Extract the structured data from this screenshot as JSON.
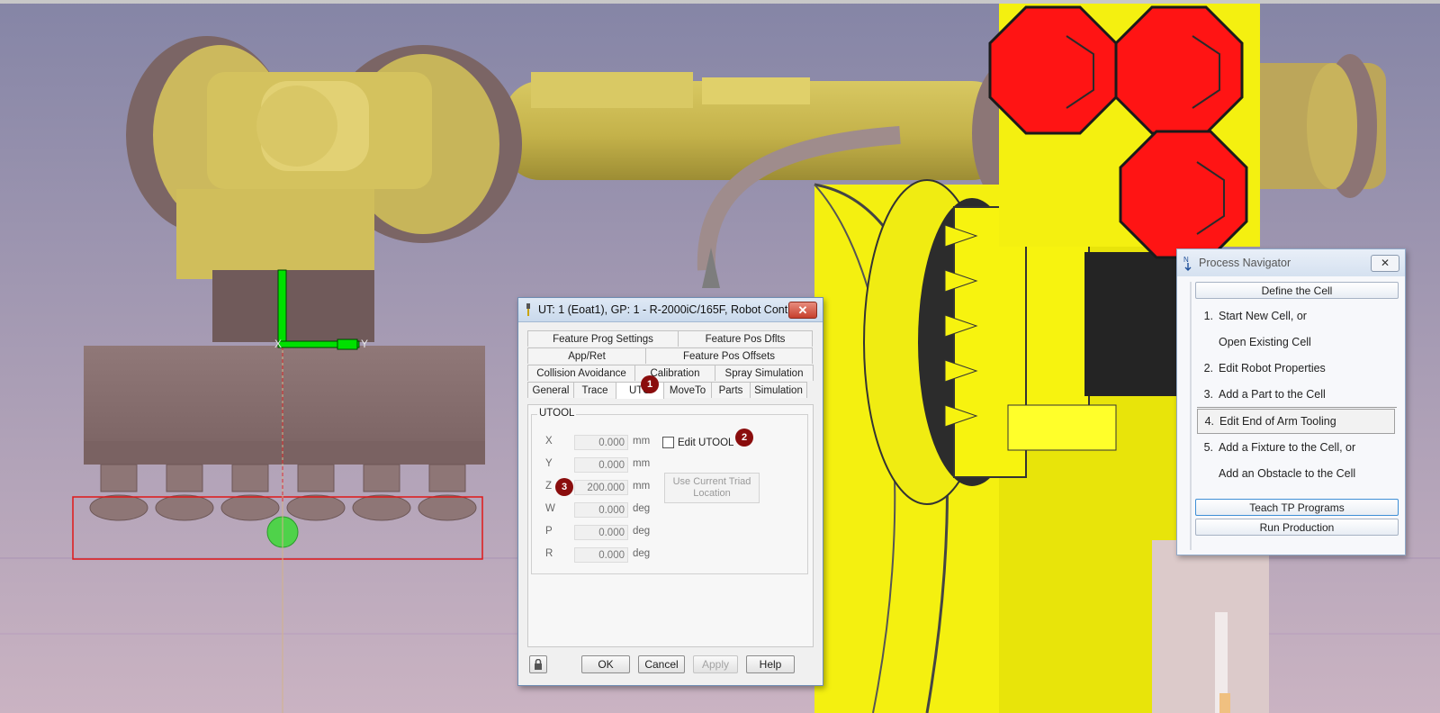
{
  "viewport": {
    "triad_axis_x": "X",
    "triad_axis_y": "Y"
  },
  "utool_dialog": {
    "title": "UT: 1  (Eoat1), GP: 1 - R-2000iC/165F, Robot Contr...",
    "close_label": "✕",
    "tabs_row1": [
      "Feature Prog Settings",
      "Feature Pos Dflts"
    ],
    "tabs_row2": [
      "App/Ret",
      "Feature Pos Offsets"
    ],
    "tabs_row3": [
      "Collision Avoidance",
      "Calibration",
      "Spray Simulation"
    ],
    "tabs_row4": [
      "General",
      "Trace",
      "UTO",
      "MoveTo",
      "Parts",
      "Simulation"
    ],
    "active_tab": "UTOOL",
    "group_label": "UTOOL",
    "fields": [
      {
        "label": "X",
        "value": "0.000",
        "unit": "mm"
      },
      {
        "label": "Y",
        "value": "0.000",
        "unit": "mm"
      },
      {
        "label": "Z",
        "value": "200.000",
        "unit": "mm"
      },
      {
        "label": "W",
        "value": "0.000",
        "unit": "deg"
      },
      {
        "label": "P",
        "value": "0.000",
        "unit": "deg"
      },
      {
        "label": "R",
        "value": "0.000",
        "unit": "deg"
      }
    ],
    "edit_utool_label": "Edit UTOOL",
    "edit_utool_checked": false,
    "use_triad_line1": "Use Current Triad",
    "use_triad_line2": "Location",
    "badges": [
      "1",
      "2",
      "3"
    ],
    "buttons": {
      "ok": "OK",
      "cancel": "Cancel",
      "apply": "Apply",
      "help": "Help"
    }
  },
  "process_navigator": {
    "title": "Process Navigator",
    "close_label": "✕",
    "define_cell": "Define the Cell",
    "steps": [
      {
        "num": "1.",
        "text": "Start New Cell, or"
      },
      {
        "num": "",
        "text": "Open Existing Cell"
      },
      {
        "num": "2.",
        "text": "Edit Robot Properties"
      },
      {
        "num": "3.",
        "text": "Add a Part to the Cell"
      },
      {
        "num": "4.",
        "text": "Edit End of Arm Tooling"
      },
      {
        "num": "5.",
        "text": "Add a Fixture to the Cell, or"
      },
      {
        "num": "",
        "text": "Add an Obstacle to the Cell"
      }
    ],
    "selected_step": "4.",
    "teach": "Teach TP Programs",
    "run": "Run Production"
  },
  "colors": {
    "sky_top": "#8787a7",
    "sky_bottom": "#c8b2c2",
    "robot_yellow": "#ffff2e",
    "robot_gold": "#d4c45a",
    "tool_mauve": "#8c7474",
    "red_octagon": "#ff1414",
    "badge": "#8a0d0d",
    "triad_green": "#00e000"
  }
}
